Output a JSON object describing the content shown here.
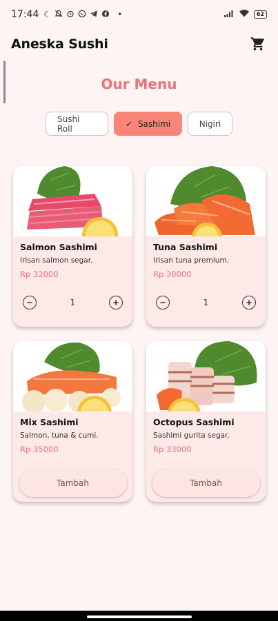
{
  "status_bar": {
    "time": "17:44",
    "left_icons": [
      "moon-icon",
      "notifications-off-icon",
      "alarm-icon",
      "whatsapp-icon",
      "telegram-icon",
      "facebook-icon",
      "dot-icon"
    ],
    "battery": "62"
  },
  "app_bar": {
    "title": "Aneska Sushi",
    "cart_icon": "cart-icon"
  },
  "section_title": "Our Menu",
  "categories": [
    {
      "label": "Sushi Roll",
      "selected": false
    },
    {
      "label": "Sashimi",
      "selected": true
    },
    {
      "label": "Nigiri",
      "selected": false
    }
  ],
  "items": [
    {
      "name": "Salmon Sashimi",
      "description": "Irisan salmon segar.",
      "price": "Rp 32000",
      "quantity": "1",
      "image": "tuna-sashimi-image"
    },
    {
      "name": "Tuna Sashimi",
      "description": "Irisan tuna premium.",
      "price": "Rp 30000",
      "quantity": "1",
      "image": "salmon-sashimi-image"
    },
    {
      "name": "Mix Sashimi",
      "description": "Salmon, tuna & cumi.",
      "price": "Rp 35000",
      "button": "Tambah",
      "image": "mix-sashimi-image"
    },
    {
      "name": "Octopus Sashimi",
      "description": "Sashimi gurita segar.",
      "price": "Rp 33000",
      "button": "Tambah",
      "image": "octopus-sashimi-image"
    }
  ],
  "colors": {
    "background": "#fdf4f3",
    "accent": "#e8737a",
    "chip_selected": "#f98578",
    "card": "#fde9e7"
  }
}
